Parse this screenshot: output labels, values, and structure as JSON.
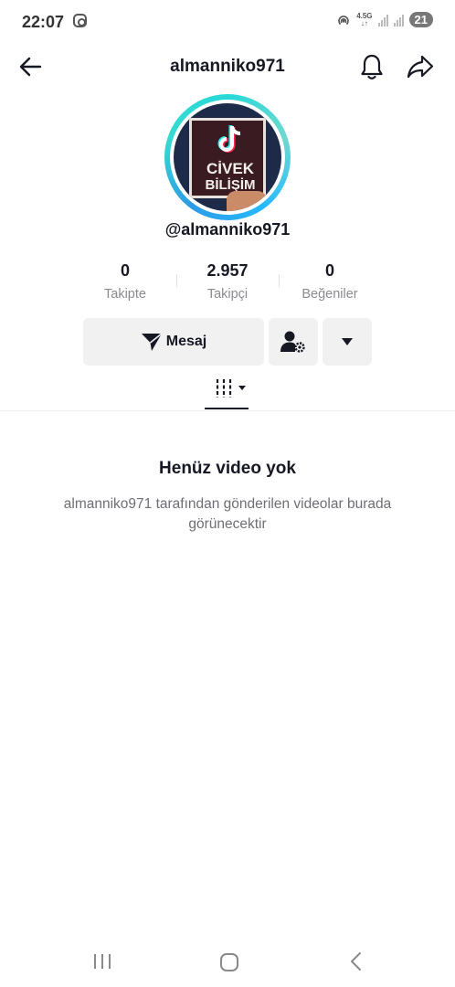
{
  "status_bar": {
    "time": "22:07",
    "network_line1": "4.5G",
    "network_line2": "↓↑",
    "battery": "21"
  },
  "header": {
    "title": "almanniko971"
  },
  "profile": {
    "avatar_text_line1": "CİVEK",
    "avatar_text_line2": "BİLİŞİM",
    "handle": "@almanniko971"
  },
  "stats": [
    {
      "value": "0",
      "label": "Takipte"
    },
    {
      "value": "2.957",
      "label": "Takipçi"
    },
    {
      "value": "0",
      "label": "Beğeniler"
    }
  ],
  "actions": {
    "message_label": "Mesaj"
  },
  "empty_state": {
    "title": "Henüz video yok",
    "subtitle": "almanniko971 tarafından gönderilen videolar burada görünecektir"
  },
  "colors": {
    "text": "#161823",
    "muted": "#8a8b91",
    "button_bg": "#f1f1f2",
    "ring_teal": "#26d8d8",
    "ring_blue": "#25b9ff"
  }
}
